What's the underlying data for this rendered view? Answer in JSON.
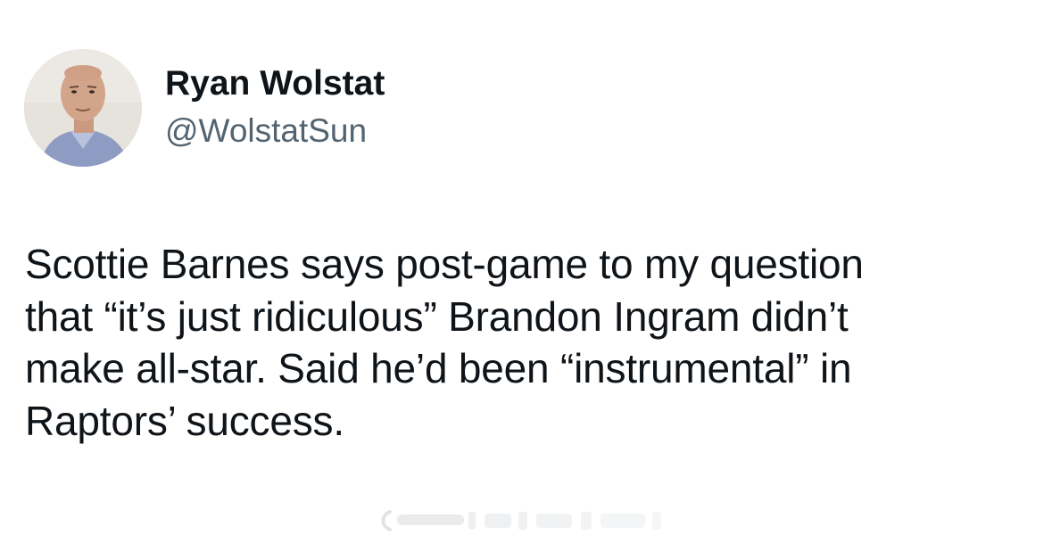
{
  "author": {
    "display_name": "Ryan Wolstat",
    "handle": "@WolstatSun"
  },
  "tweet": {
    "lines": [
      "Scottie Barnes says post-game to my question",
      "that “it’s just ridiculous” Brandon Ingram didn’t",
      "make all-star. Said he’d been “instrumental” in",
      "Raptors’ success."
    ]
  },
  "colors": {
    "text_primary": "#0f1419",
    "text_secondary": "#536471",
    "background": "#ffffff"
  }
}
